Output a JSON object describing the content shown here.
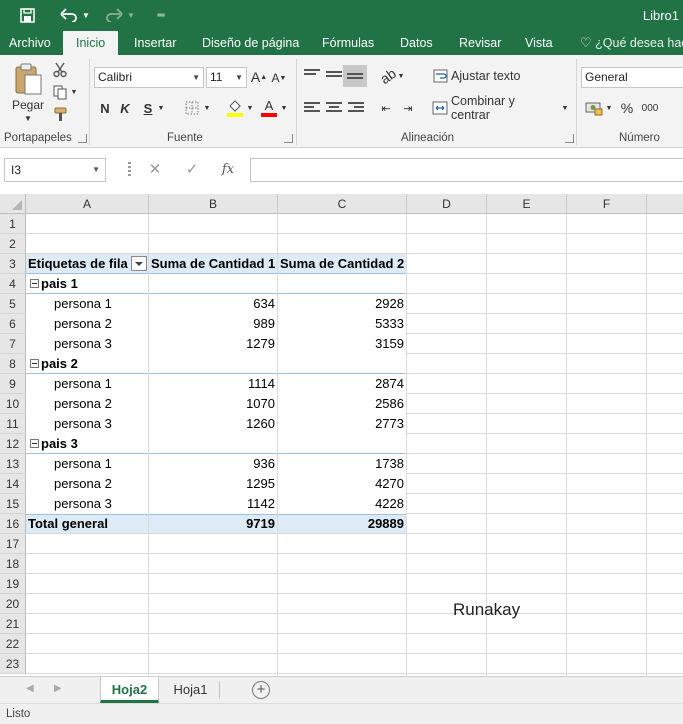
{
  "window": {
    "title": "Libro1"
  },
  "qat": {
    "save_icon": "save-icon",
    "undo_icon": "undo-icon",
    "redo_icon": "redo-icon",
    "customize_icon": "customize-qat-icon"
  },
  "ribbon_tabs": [
    "Archivo",
    "Inicio",
    "Insertar",
    "Diseño de página",
    "Fórmulas",
    "Datos",
    "Revisar",
    "Vista"
  ],
  "tell_me": "¿Qué desea hace",
  "ribbon": {
    "clipboard": {
      "label": "Portapapeles",
      "paste": "Pegar"
    },
    "font": {
      "label": "Fuente",
      "font_name": "Calibri",
      "font_size": "11",
      "bold": "N",
      "italic": "K",
      "underline": "S",
      "grow": "A",
      "shrink": "A",
      "color_letter": "A",
      "fill_color": "#ffff00",
      "font_color": "#ff0000"
    },
    "alignment": {
      "label": "Alineación",
      "wrap": "Ajustar texto",
      "merge": "Combinar y centrar"
    },
    "number": {
      "label": "Número",
      "format": "General",
      "percent": "%",
      "thousands": "000"
    }
  },
  "formula_bar": {
    "name_box": "I3",
    "cancel": "✕",
    "enter": "✓",
    "fx": "fx",
    "value": ""
  },
  "columns": [
    "A",
    "B",
    "C",
    "D",
    "E",
    "F"
  ],
  "rows": [
    "1",
    "2",
    "3",
    "4",
    "5",
    "6",
    "7",
    "8",
    "9",
    "10",
    "11",
    "12",
    "13",
    "14",
    "15",
    "16",
    "17",
    "18",
    "19",
    "20",
    "21",
    "22",
    "23"
  ],
  "pivot": {
    "header": {
      "row_labels": "Etiquetas de fila",
      "sum1": "Suma de Cantidad 1",
      "sum2": "Suma de Cantidad 2"
    },
    "groups": [
      {
        "name": "pais 1",
        "items": [
          {
            "label": "persona 1",
            "c1": "634",
            "c2": "2928"
          },
          {
            "label": "persona 2",
            "c1": "989",
            "c2": "5333"
          },
          {
            "label": "persona 3",
            "c1": "1279",
            "c2": "3159"
          }
        ]
      },
      {
        "name": "pais 2",
        "items": [
          {
            "label": "persona 1",
            "c1": "1114",
            "c2": "2874"
          },
          {
            "label": "persona 2",
            "c1": "1070",
            "c2": "2586"
          },
          {
            "label": "persona 3",
            "c1": "1260",
            "c2": "2773"
          }
        ]
      },
      {
        "name": "pais 3",
        "items": [
          {
            "label": "persona 1",
            "c1": "936",
            "c2": "1738"
          },
          {
            "label": "persona 2",
            "c1": "1295",
            "c2": "4270"
          },
          {
            "label": "persona 3",
            "c1": "1142",
            "c2": "4228"
          }
        ]
      }
    ],
    "total": {
      "label": "Total general",
      "c1": "9719",
      "c2": "29889"
    }
  },
  "floating_text": "Runakay",
  "sheets": {
    "active": "Hoja2",
    "other": "Hoja1",
    "add": "+"
  },
  "status": "Listo"
}
